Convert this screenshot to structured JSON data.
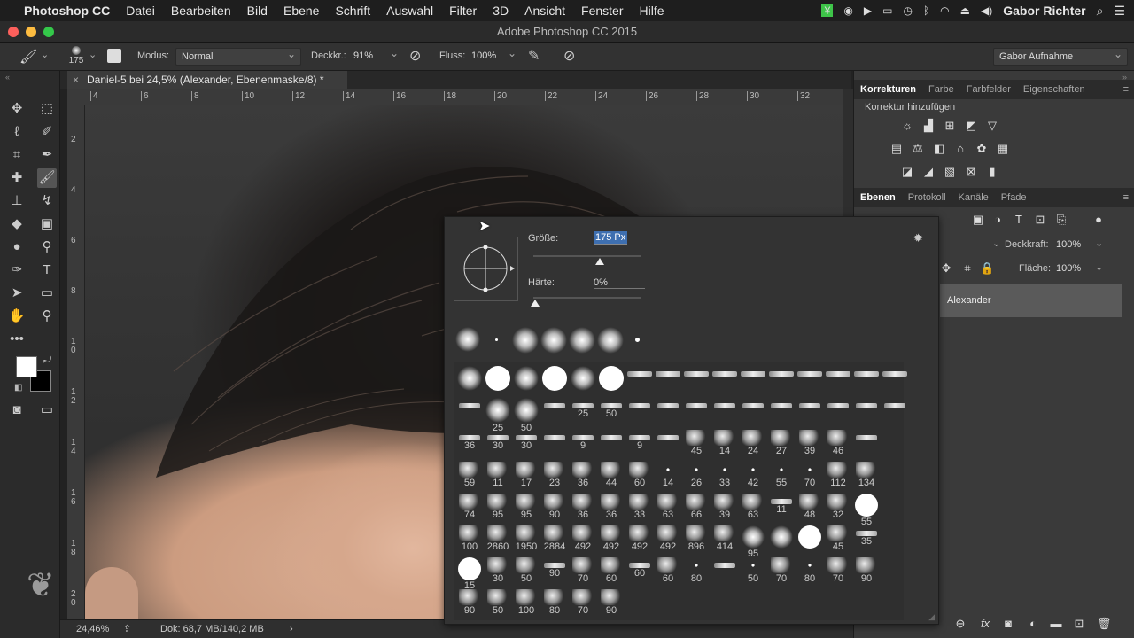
{
  "menubar": {
    "apple": "",
    "app": "Photoshop CC",
    "items": [
      "Datei",
      "Bearbeiten",
      "Bild",
      "Ebene",
      "Schrift",
      "Auswahl",
      "Filter",
      "3D",
      "Ansicht",
      "Fenster",
      "Hilfe"
    ],
    "user": "Gabor Richter"
  },
  "window": {
    "title": "Adobe Photoshop CC 2015"
  },
  "options": {
    "brush_size": "175",
    "mode_label": "Modus:",
    "mode_value": "Normal",
    "opacity_label": "Deckkr.:",
    "opacity_value": "91%",
    "flow_label": "Fluss:",
    "flow_value": "100%",
    "workspace": "Gabor Aufnahme"
  },
  "document": {
    "tab": "Daniel-5 bei 24,5% (Alexander, Ebenenmaske/8) *",
    "close": "×"
  },
  "ruler": {
    "h": [
      "4",
      "6",
      "8",
      "10",
      "12",
      "14",
      "16",
      "18",
      "20",
      "22",
      "24",
      "26",
      "28",
      "30",
      "32"
    ],
    "v": [
      "2",
      "4",
      "6",
      "8",
      "1 0",
      "1 2",
      "1 4",
      "1 6",
      "1 8",
      "2 0"
    ]
  },
  "status": {
    "zoom": "24,46%",
    "doc": "Dok: 68,7 MB/140,2 MB",
    "arrow": "›"
  },
  "panels": {
    "adjust_tabs": [
      "Korrekturen",
      "Farbe",
      "Farbfelder",
      "Eigenschaften"
    ],
    "adjust_title": "Korrektur hinzufügen",
    "layer_tabs": [
      "Ebenen",
      "Protokoll",
      "Kanäle",
      "Pfade"
    ],
    "opacity_label": "Deckkraft:",
    "opacity_value": "100%",
    "fill_label": "Fläche:",
    "fill_value": "100%",
    "layer_name": "Alexander"
  },
  "brush_popup": {
    "size_label": "Größe:",
    "size_value": "175 Px",
    "hardness_label": "Härte:",
    "hardness_value": "0%",
    "size_level": 0.47,
    "hardness_level": 0.0
  },
  "brush_grid": [
    [
      "",
      "",
      "",
      "",
      "",
      "",
      "",
      "",
      "",
      "",
      "",
      "",
      "",
      "",
      "",
      ""
    ],
    [
      "",
      "25",
      "50",
      "",
      "25",
      "50",
      "",
      "",
      "",
      "",
      "",
      "",
      "",
      "",
      "",
      ""
    ],
    [
      "36",
      "30",
      "30",
      "",
      "9",
      "",
      "9",
      "",
      "45",
      "14",
      "24",
      "27",
      "39",
      "46",
      "",
      ""
    ],
    [
      "59",
      "11",
      "17",
      "23",
      "36",
      "44",
      "60",
      "14",
      "26",
      "33",
      "42",
      "55",
      "70",
      "112",
      "134",
      ""
    ],
    [
      "74",
      "95",
      "95",
      "90",
      "36",
      "36",
      "33",
      "63",
      "66",
      "39",
      "63",
      "11",
      "48",
      "32",
      "55",
      ""
    ],
    [
      "100",
      "2860",
      "1950",
      "2884",
      "492",
      "492",
      "492",
      "492",
      "896",
      "414",
      "95",
      "",
      "",
      "45",
      "35",
      ""
    ],
    [
      "15",
      "30",
      "50",
      "90",
      "70",
      "60",
      "60",
      "60",
      "80",
      "",
      "50",
      "70",
      "80",
      "70",
      "90",
      ""
    ],
    [
      "90",
      "50",
      "100",
      "80",
      "70",
      "90",
      "",
      "",
      "",
      "",
      "",
      "",
      "",
      "",
      "",
      ""
    ]
  ]
}
